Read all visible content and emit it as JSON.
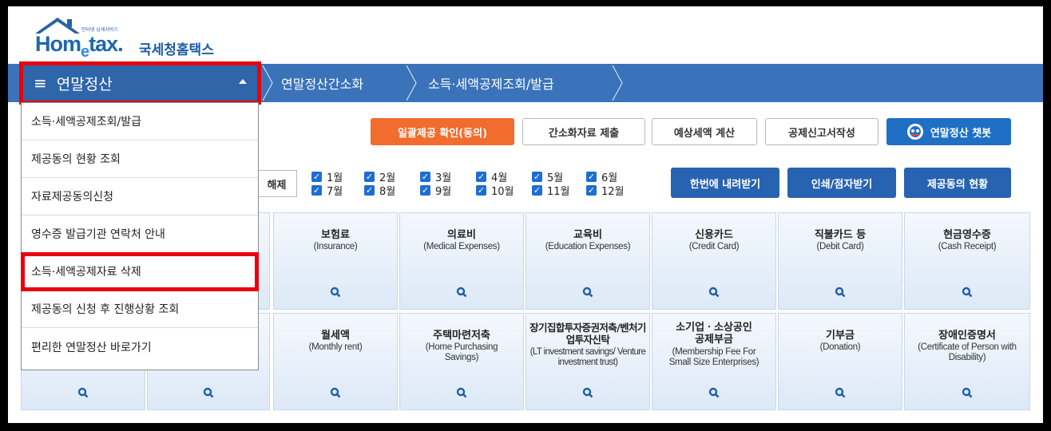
{
  "logo": {
    "word_pre": "Hom",
    "word_e": "e",
    "word_post": "tax.",
    "korean": "국세청홈택스",
    "tagline": "인터넷 납세서비스"
  },
  "nav": {
    "menu_label": "연말정산",
    "breadcrumbs": [
      "연말정산간소화",
      "소득·세액공제조회/발급"
    ]
  },
  "dropdown": {
    "items": [
      "소득·세액공제조회/발급",
      "제공동의 현황 조회",
      "자료제공동의신청",
      "영수증 발급기관 연락처 안내",
      "소득·세액공제자료 삭제",
      "제공동의 신청 후 진행상황 조회",
      "편리한 연말정산 바로가기"
    ],
    "highlighted_index": 4
  },
  "actions": {
    "consent_check": "일괄제공 확인(동의)",
    "simplified_submit": "간소화자료 제출",
    "tax_estimate": "예상세액 계산",
    "deduction_form": "공제신고서작성",
    "chatbot": "연말정산 챗봇"
  },
  "months": {
    "clear": "해제",
    "list": [
      "1월",
      "2월",
      "3월",
      "4월",
      "5월",
      "6월",
      "7월",
      "8월",
      "9월",
      "10월",
      "11월",
      "12월"
    ],
    "checked": true
  },
  "bulk": {
    "download_all": "한번에 내려받기",
    "print": "인쇄/점자받기",
    "consent_status": "제공동의 현황"
  },
  "tiles_row1": [
    {
      "ko": "보험료",
      "en": "(Insurance)"
    },
    {
      "ko": "의료비",
      "en": "(Medical Expenses)"
    },
    {
      "ko": "교육비",
      "en": "(Education Expenses)"
    },
    {
      "ko": "신용카드",
      "en": "(Credit Card)"
    },
    {
      "ko": "직불카드 등",
      "en": "(Debit Card)"
    },
    {
      "ko": "현금영수증",
      "en": "(Cash Receipt)"
    }
  ],
  "tiles_row2": [
    {
      "ko": "월세액",
      "en": "(Monthly rent)"
    },
    {
      "ko": "주택마련저축",
      "en": "(Home Purchasing Savings)"
    },
    {
      "ko": "장기집합투자증권저축/벤처기업투자신탁",
      "en": "(LT investment savings/ Venture investment trust)"
    },
    {
      "ko": "소기업ㆍ소상공인 공제부금",
      "en": "(Membership Fee For Small Size Enterprises)"
    },
    {
      "ko": "기부금",
      "en": "(Donation)"
    },
    {
      "ko": "장애인증명서",
      "en": "(Certificate of Person with Disability)"
    }
  ],
  "colors": {
    "nav_blue": "#3a73b9",
    "highlight_red": "#e8000d",
    "orange": "#f26c2e",
    "action_blue": "#1f6fc5"
  },
  "icons": [
    "menu-icon",
    "caret-up-icon",
    "magnifier-icon",
    "chatbot-icon",
    "checkbox-icon"
  ]
}
